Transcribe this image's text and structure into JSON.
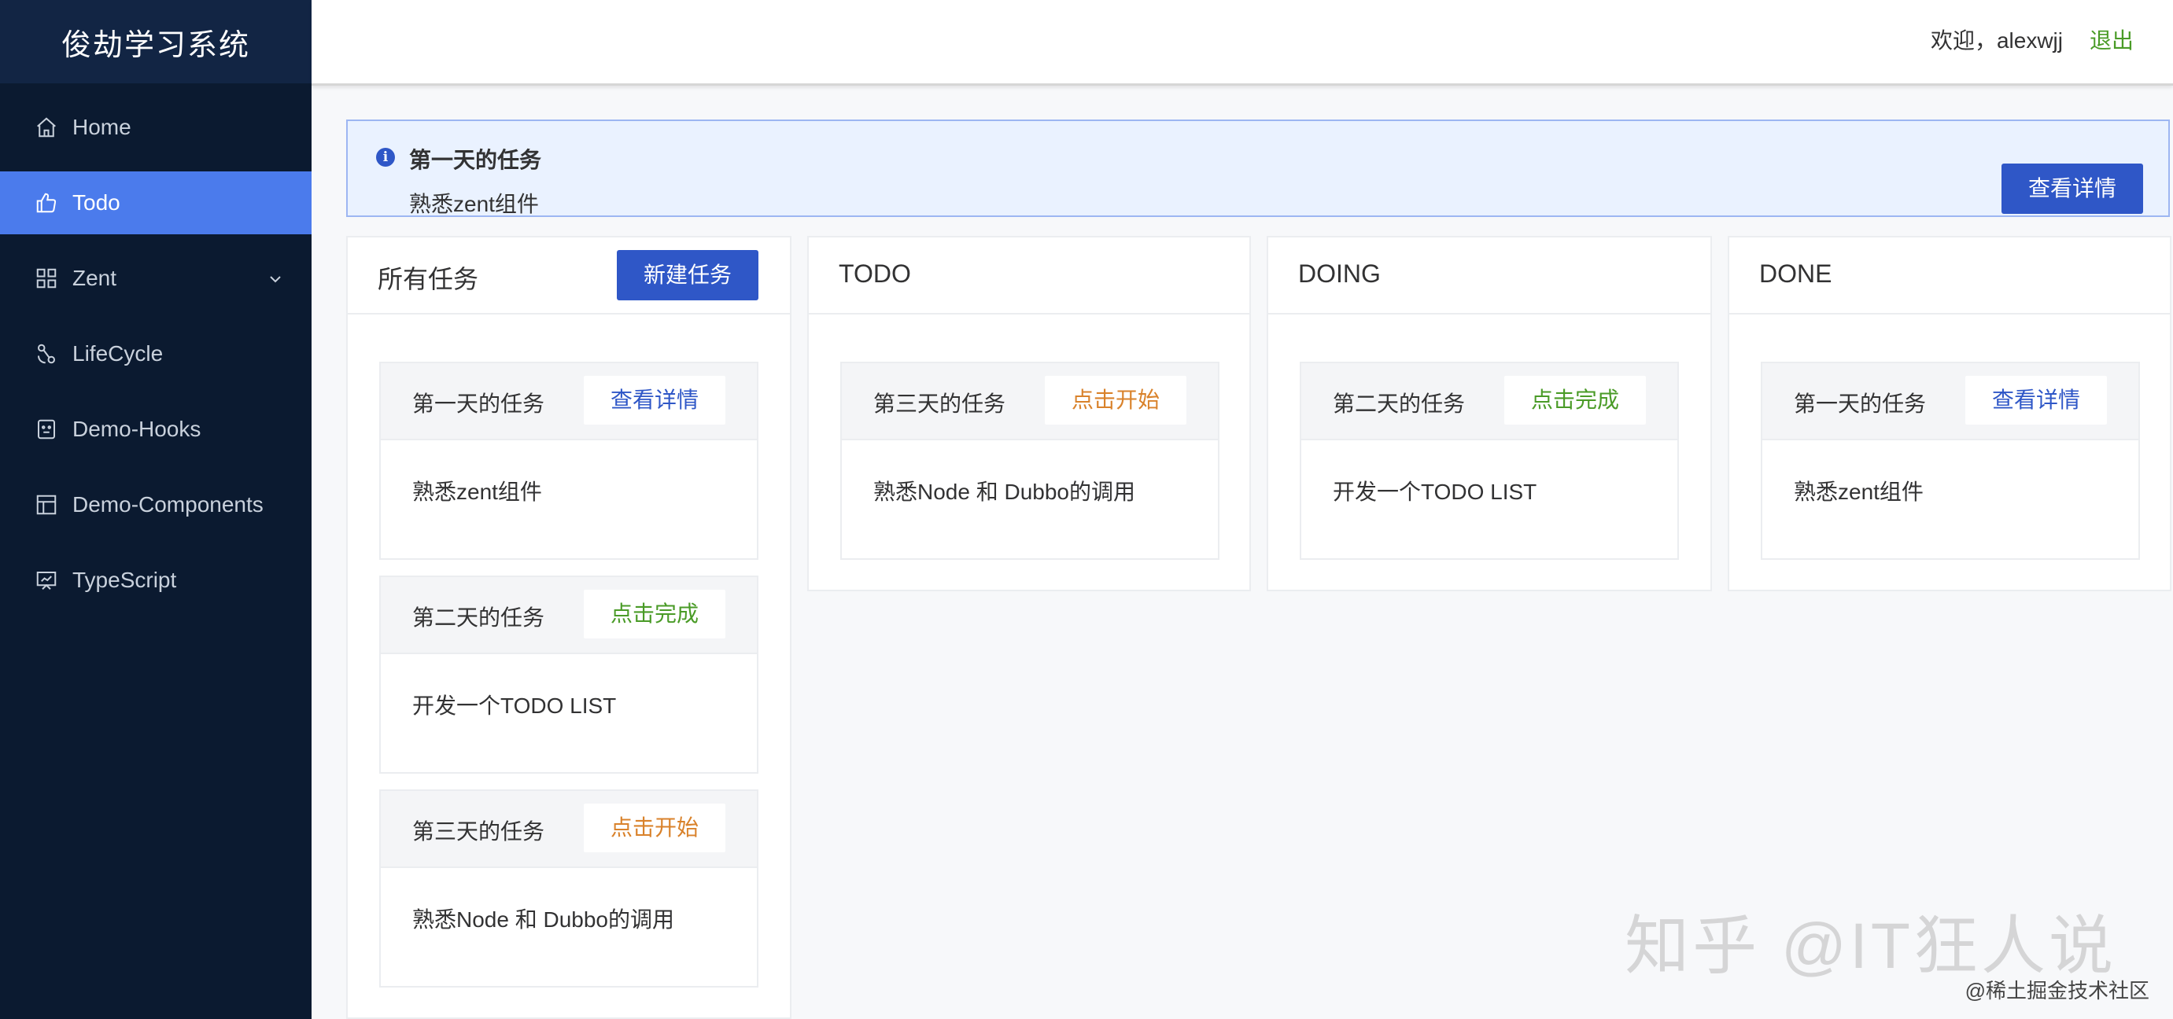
{
  "app": {
    "brand": "俊劫学习系统"
  },
  "sidebar": {
    "items": [
      {
        "label": "Home",
        "icon": "home-icon"
      },
      {
        "label": "Todo",
        "icon": "thumbs-up-icon",
        "active": true
      },
      {
        "label": "Zent",
        "icon": "grid-icon",
        "expandable": true
      },
      {
        "label": "LifeCycle",
        "icon": "cycle-icon"
      },
      {
        "label": "Demo-Hooks",
        "icon": "robot-icon"
      },
      {
        "label": "Demo-Components",
        "icon": "layout-icon"
      },
      {
        "label": "TypeScript",
        "icon": "presentation-icon"
      }
    ]
  },
  "header": {
    "welcome": "欢迎，alexwjj",
    "logout": "退出"
  },
  "notice": {
    "title": "第一天的任务",
    "desc": "熟悉zent组件",
    "button": "查看详情"
  },
  "columns": [
    {
      "title": "所有任务",
      "button": "新建任务",
      "cards": [
        {
          "title": "第一天的任务",
          "action": "查看详情",
          "action_color": "#2f57c7",
          "body": "熟悉zent组件"
        },
        {
          "title": "第二天的任务",
          "action": "点击完成",
          "action_color": "#4a9b27",
          "body": "开发一个TODO LIST"
        },
        {
          "title": "第三天的任务",
          "action": "点击开始",
          "action_color": "#d9822b",
          "body": "熟悉Node 和 Dubbo的调用"
        }
      ]
    },
    {
      "title": "TODO",
      "cards": [
        {
          "title": "第三天的任务",
          "action": "点击开始",
          "action_color": "#d9822b",
          "body": "熟悉Node 和 Dubbo的调用"
        }
      ]
    },
    {
      "title": "DOING",
      "cards": [
        {
          "title": "第二天的任务",
          "action": "点击完成",
          "action_color": "#4a9b27",
          "body": "开发一个TODO LIST"
        }
      ]
    },
    {
      "title": "DONE",
      "cards": [
        {
          "title": "第一天的任务",
          "action": "查看详情",
          "action_color": "#2f57c7",
          "body": "熟悉zent组件"
        }
      ]
    }
  ],
  "watermark": {
    "main": "知乎 @IT狂人说",
    "sub": "@稀土掘金技术社区"
  },
  "colors": {
    "sidebar_bg": "#0b1a30",
    "active_item": "#4b7bec",
    "primary": "#2f57c7"
  }
}
